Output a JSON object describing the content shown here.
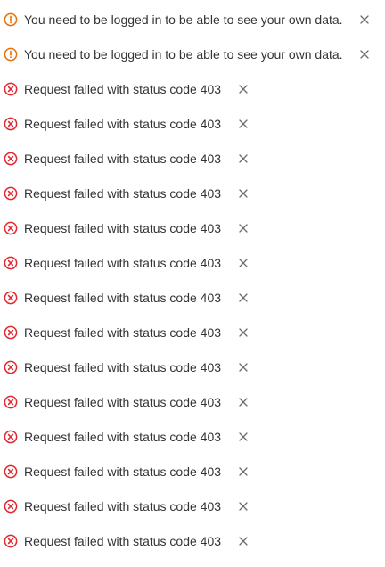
{
  "colors": {
    "warning": "#e8710a",
    "error": "#e0282e",
    "text": "#333333",
    "close": "#6b6b6b"
  },
  "notifications": [
    {
      "type": "warning",
      "icon": "warning-circle-icon",
      "message": "You need to be logged in to be able to see your own data."
    },
    {
      "type": "warning",
      "icon": "warning-circle-icon",
      "message": "You need to be logged in to be able to see your own data."
    },
    {
      "type": "error",
      "icon": "error-circle-x-icon",
      "message": "Request failed with status code 403"
    },
    {
      "type": "error",
      "icon": "error-circle-x-icon",
      "message": "Request failed with status code 403"
    },
    {
      "type": "error",
      "icon": "error-circle-x-icon",
      "message": "Request failed with status code 403"
    },
    {
      "type": "error",
      "icon": "error-circle-x-icon",
      "message": "Request failed with status code 403"
    },
    {
      "type": "error",
      "icon": "error-circle-x-icon",
      "message": "Request failed with status code 403"
    },
    {
      "type": "error",
      "icon": "error-circle-x-icon",
      "message": "Request failed with status code 403"
    },
    {
      "type": "error",
      "icon": "error-circle-x-icon",
      "message": "Request failed with status code 403"
    },
    {
      "type": "error",
      "icon": "error-circle-x-icon",
      "message": "Request failed with status code 403"
    },
    {
      "type": "error",
      "icon": "error-circle-x-icon",
      "message": "Request failed with status code 403"
    },
    {
      "type": "error",
      "icon": "error-circle-x-icon",
      "message": "Request failed with status code 403"
    },
    {
      "type": "error",
      "icon": "error-circle-x-icon",
      "message": "Request failed with status code 403"
    },
    {
      "type": "error",
      "icon": "error-circle-x-icon",
      "message": "Request failed with status code 403"
    },
    {
      "type": "error",
      "icon": "error-circle-x-icon",
      "message": "Request failed with status code 403"
    },
    {
      "type": "error",
      "icon": "error-circle-x-icon",
      "message": "Request failed with status code 403"
    }
  ]
}
